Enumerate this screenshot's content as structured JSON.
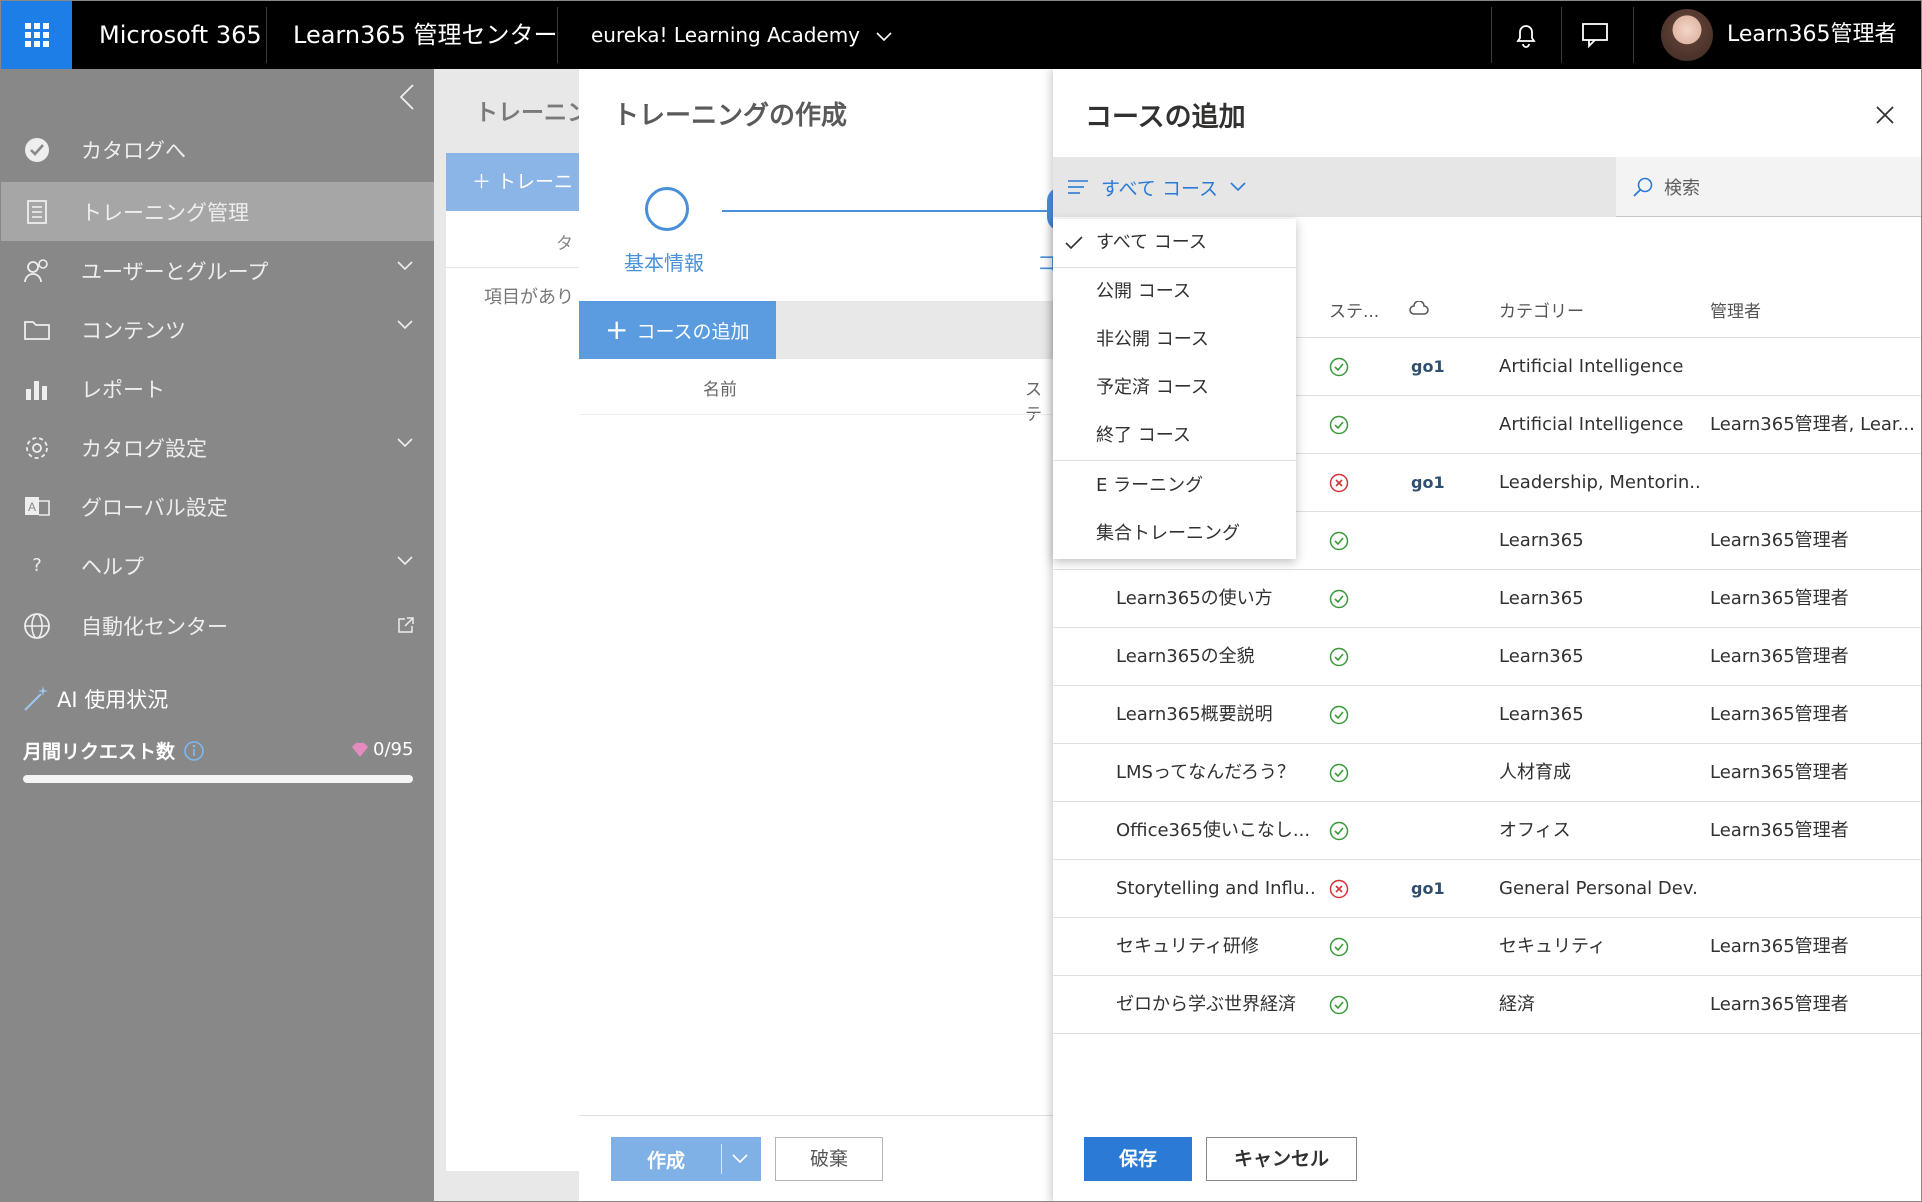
{
  "topbar": {
    "app_name": "Microsoft 365",
    "center_name": "Learn365 管理センター",
    "tenant": "eureka! Learning Academy",
    "user": "Learn365管理者"
  },
  "sidebar": {
    "items": [
      {
        "label": "カタログへ",
        "icon": "check-circle-icon",
        "chevron": false
      },
      {
        "label": "トレーニング管理",
        "icon": "document-list-icon",
        "chevron": false,
        "selected": true
      },
      {
        "label": "ユーザーとグループ",
        "icon": "people-icon",
        "chevron": true
      },
      {
        "label": "コンテンツ",
        "icon": "folder-icon",
        "chevron": true
      },
      {
        "label": "レポート",
        "icon": "bar-chart-icon",
        "chevron": false
      },
      {
        "label": "カタログ設定",
        "icon": "gear-icon",
        "chevron": true
      },
      {
        "label": "グローバル設定",
        "icon": "translate-icon",
        "chevron": false
      },
      {
        "label": "ヘルプ",
        "icon": "question-icon",
        "chevron": true
      },
      {
        "label": "自動化センター",
        "icon": "globe-icon",
        "chevron": false
      }
    ],
    "ai_title": "AI 使用状況",
    "monthly_label": "月間リクエスト数",
    "usage": "0/95",
    "usage_fraction": 0
  },
  "bg_page": {
    "title": "トレーニン",
    "new_button": "＋ トレーニ",
    "col_header": "タ",
    "empty_text": "項目があり"
  },
  "create_panel": {
    "title": "トレーニングの作成",
    "step1_label": "基本情報",
    "step2_label": "コ",
    "add_course_button": "コースの追加",
    "col_name": "名前",
    "col_status": "ステ",
    "create_button": "作成",
    "discard_button": "破棄"
  },
  "add_panel": {
    "title": "コースの追加",
    "filter_label": "すべて コース",
    "search_placeholder": "検索",
    "headers": {
      "status": "ステ...",
      "category": "カテゴリー",
      "manager": "管理者"
    },
    "rows": [
      {
        "name": "",
        "status": "ok",
        "go1": true,
        "category": "Artificial Intelligence",
        "manager": ""
      },
      {
        "name": "",
        "status": "ok",
        "go1": false,
        "category": "Artificial Intelligence",
        "manager": "Learn365管理者, Lear..."
      },
      {
        "name": "",
        "status": "error",
        "go1": true,
        "category": "Leadership, Mentorin...",
        "manager": ""
      },
      {
        "name": "",
        "status": "ok",
        "go1": false,
        "category": "Learn365",
        "manager": "Learn365管理者"
      },
      {
        "name": "Learn365の使い方",
        "status": "ok",
        "go1": false,
        "category": "Learn365",
        "manager": "Learn365管理者"
      },
      {
        "name": "Learn365の全貌",
        "status": "ok",
        "go1": false,
        "category": "Learn365",
        "manager": "Learn365管理者"
      },
      {
        "name": "Learn365概要説明",
        "status": "ok",
        "go1": false,
        "category": "Learn365",
        "manager": "Learn365管理者"
      },
      {
        "name": "LMSってなんだろう？",
        "status": "ok",
        "go1": false,
        "category": "人材育成",
        "manager": "Learn365管理者"
      },
      {
        "name": "Office365使いこなし...",
        "status": "ok",
        "go1": false,
        "category": "オフィス",
        "manager": "Learn365管理者"
      },
      {
        "name": "Storytelling and Influ...",
        "status": "error",
        "go1": true,
        "category": "General Personal Dev...",
        "manager": ""
      },
      {
        "name": "セキュリティ研修",
        "status": "ok",
        "go1": false,
        "category": "セキュリティ",
        "manager": "Learn365管理者"
      },
      {
        "name": "ゼロから学ぶ世界経済",
        "status": "ok",
        "go1": false,
        "category": "経済",
        "manager": "Learn365管理者"
      }
    ],
    "go1_label": "go1",
    "save_button": "保存",
    "cancel_button": "キャンセル"
  },
  "dropdown": {
    "items": [
      {
        "label": "すべて コース",
        "checked": true
      },
      {
        "label": "公開 コース"
      },
      {
        "label": "非公開 コース"
      },
      {
        "label": "予定済 コース"
      },
      {
        "label": "終了 コース"
      },
      {
        "label": "E ラーニング"
      },
      {
        "label": "集合トレーニング"
      }
    ]
  },
  "colors": {
    "accent": "#1e7ee8",
    "primary_button": "#2b7ad6",
    "ok": "#3a9a3a",
    "error": "#d13438",
    "step": "#4a90d9"
  }
}
